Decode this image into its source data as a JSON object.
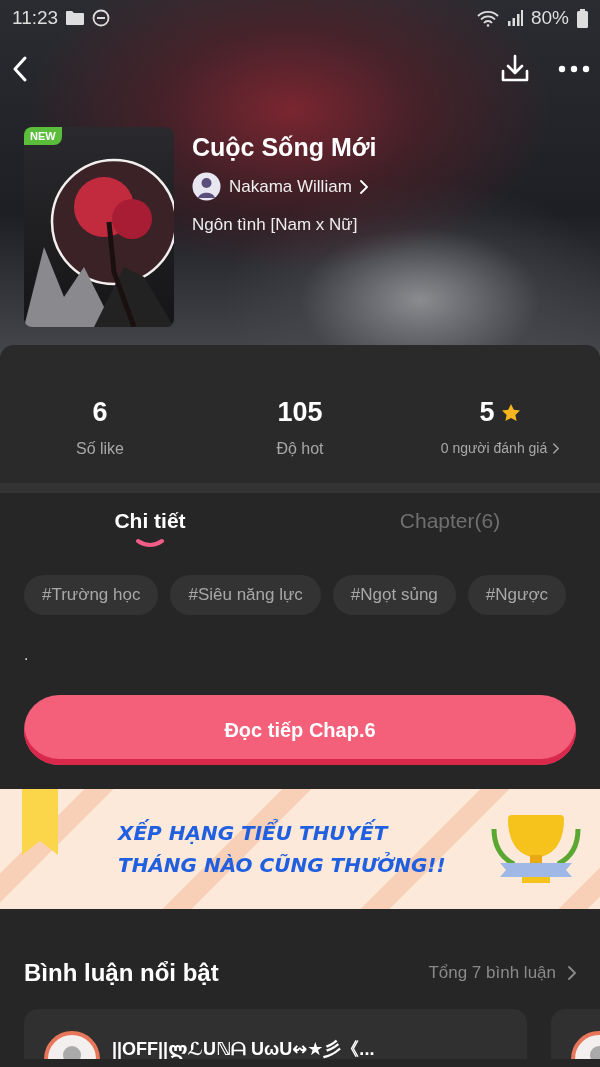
{
  "status_bar": {
    "time": "11:23",
    "battery": "80%"
  },
  "book": {
    "badge": "NEW",
    "title": "Cuộc Sống Mới",
    "author": "Nakama William",
    "genre": "Ngôn tình [Nam x Nữ]"
  },
  "stats": [
    {
      "kind": "plain",
      "value": "6",
      "label": "Số like"
    },
    {
      "kind": "plain",
      "value": "105",
      "label": "Độ hot"
    },
    {
      "kind": "rating",
      "value": "5",
      "label": "0 người đánh giá"
    }
  ],
  "tabs": [
    {
      "label": "Chi tiết",
      "selected": true
    },
    {
      "label": "Chapter(6)",
      "selected": false
    }
  ],
  "tags": [
    "#Trường học",
    "#Siêu năng lực",
    "#Ngọt sủng",
    "#Ngược"
  ],
  "description": ".",
  "read_button": "Đọc tiếp Chap.6",
  "banner": {
    "lines": [
      "XẾP HẠNG TIỂU THUYẾT",
      "THÁNG NÀO CŨNG THƯỞNG!!"
    ]
  },
  "comments": {
    "title": "Bình luận nổi bật",
    "total": "Tổng 7 bình luận",
    "items": [
      {
        "user": "||OFF||ლℒUℕᗩ UωU↭★彡《..."
      }
    ]
  }
}
